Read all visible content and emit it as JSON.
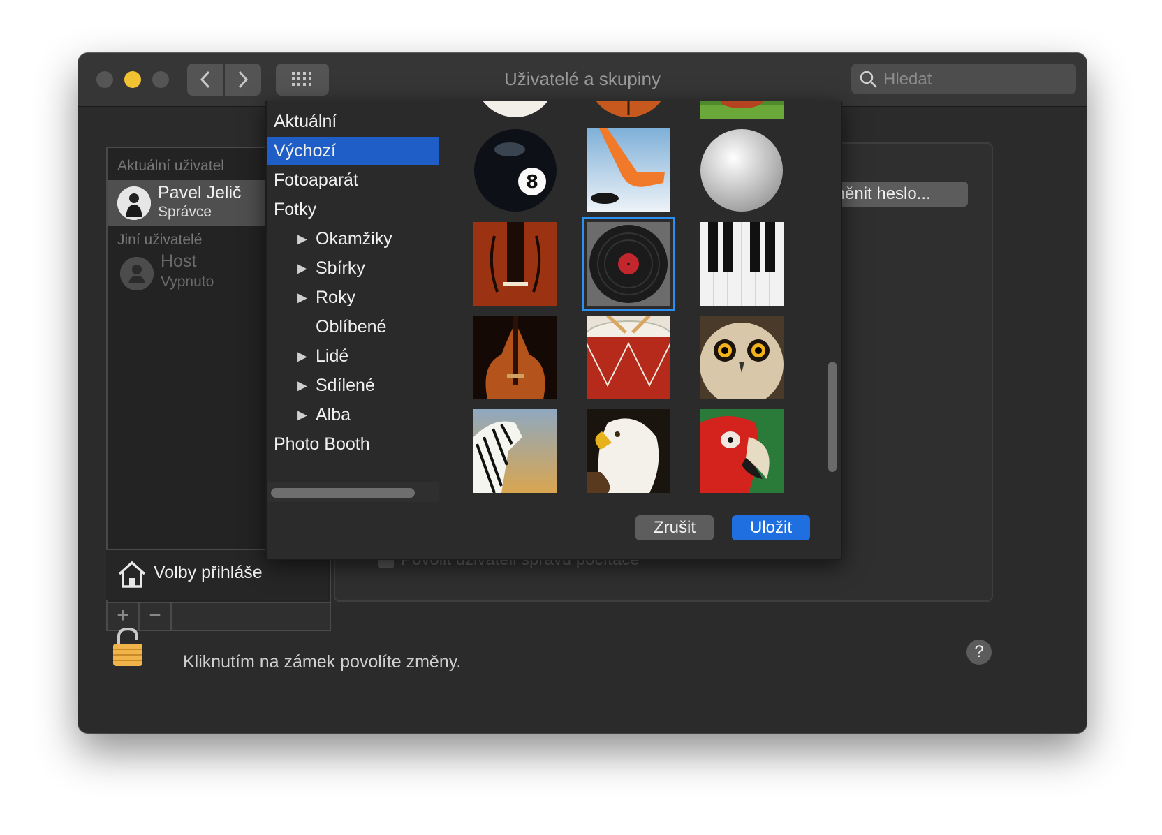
{
  "window": {
    "title": "Uživatelé a skupiny",
    "search_placeholder": "Hledat"
  },
  "users": {
    "current_label": "Aktuální uživatel",
    "current_user": {
      "name": "Pavel Jelič",
      "role": "Správce"
    },
    "others_label": "Jiní uživatelé",
    "other_user": {
      "name": "Host",
      "status": "Vypnuto"
    },
    "login_options": "Volby přihláše"
  },
  "right_panel": {
    "change_password": "změnit heslo...",
    "allow_admin": "Povolit uživateli správu počítače"
  },
  "lock_text": "Kliknutím na zámek povolíte změny.",
  "help_label": "?",
  "picker": {
    "sources": [
      {
        "label": "Aktuální",
        "level": 0,
        "expandable": false
      },
      {
        "label": "Výchozí",
        "level": 0,
        "expandable": false,
        "selected": true
      },
      {
        "label": "Fotoaparát",
        "level": 0,
        "expandable": false
      },
      {
        "label": "Fotky",
        "level": 0,
        "expandable": false
      },
      {
        "label": "Okamžiky",
        "level": 1,
        "expandable": true
      },
      {
        "label": "Sbírky",
        "level": 1,
        "expandable": true
      },
      {
        "label": "Roky",
        "level": 1,
        "expandable": true
      },
      {
        "label": "Oblíbené",
        "level": 1,
        "expandable": false
      },
      {
        "label": "Lidé",
        "level": 1,
        "expandable": true
      },
      {
        "label": "Sdílené",
        "level": 1,
        "expandable": true
      },
      {
        "label": "Alba",
        "level": 1,
        "expandable": true
      },
      {
        "label": "Photo Booth",
        "level": 0,
        "expandable": false
      }
    ],
    "pictures": [
      "baseball",
      "basketball",
      "grass",
      "8-ball",
      "hockey",
      "golf-ball",
      "violin",
      "vinyl-record",
      "piano",
      "guitar",
      "drum",
      "owl",
      "zebra",
      "eagle",
      "parrot"
    ],
    "selected_picture": "vinyl-record",
    "cancel_label": "Zrušit",
    "save_label": "Uložit"
  },
  "colors": {
    "accent": "#1f6fe0",
    "selection": "#1f5ec7",
    "minimize": "#f2c233"
  }
}
